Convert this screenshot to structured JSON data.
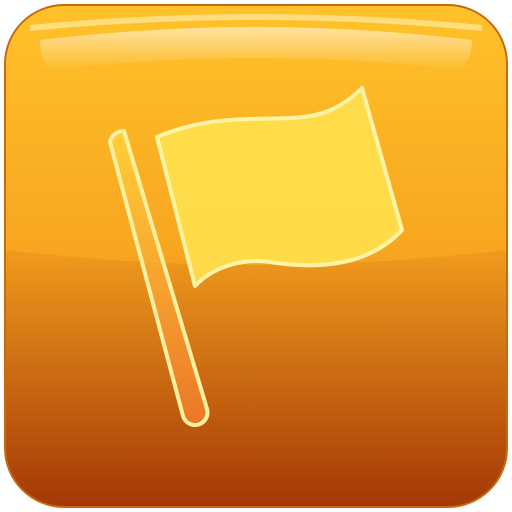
{
  "icon": {
    "name": "flag-icon",
    "colors": {
      "tile_top": "#FFC229",
      "tile_mid": "#F7A520",
      "tile_bottom": "#A93A08",
      "tile_edge": "#C86A10",
      "flag_fill": "#FFE04D",
      "flag_outline": "#FFF3A6",
      "pole_top": "#FFD23A",
      "pole_bottom": "#F07A2A"
    }
  }
}
